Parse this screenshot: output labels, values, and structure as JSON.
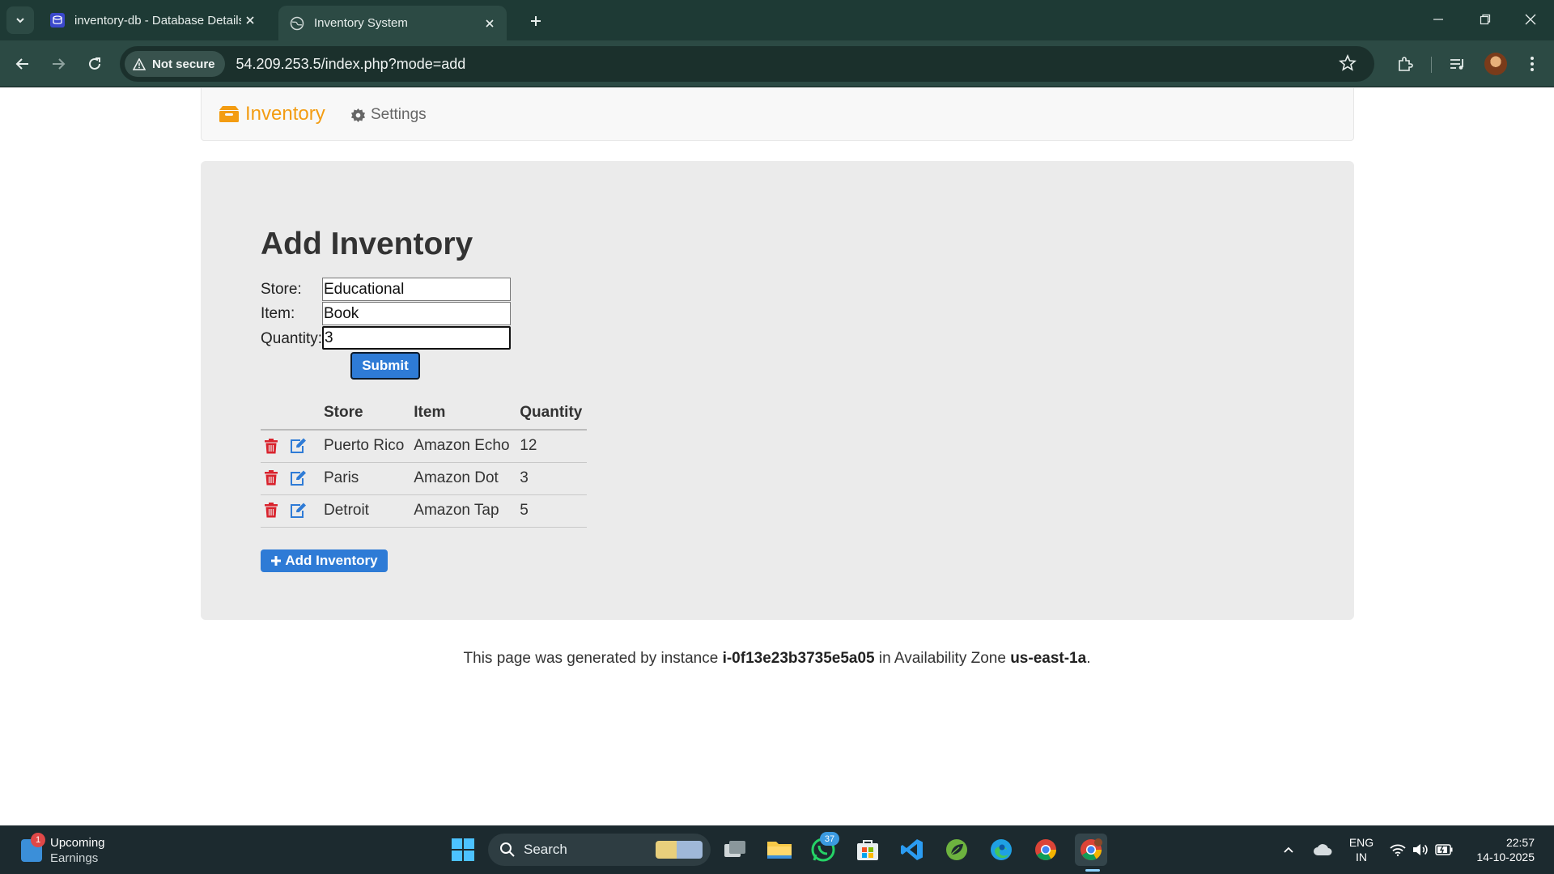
{
  "browser": {
    "tabs": [
      {
        "title": "inventory-db - Database Details",
        "active": false,
        "icon": "rds-database-icon"
      },
      {
        "title": "Inventory System",
        "active": true,
        "icon": "globe-icon"
      }
    ],
    "security_label": "Not secure",
    "url": "54.209.253.5/index.php?mode=add"
  },
  "nav": {
    "brand": "Inventory",
    "settings": "Settings",
    "brand_color": "#f39c12"
  },
  "form": {
    "title": "Add Inventory",
    "store_label": "Store:",
    "store_value": "Educational",
    "item_label": "Item:",
    "item_value": "Book",
    "quantity_label": "Quantity:",
    "quantity_value": "3",
    "submit_label": "Submit"
  },
  "table": {
    "headers": {
      "store": "Store",
      "item": "Item",
      "quantity": "Quantity"
    },
    "rows": [
      {
        "store": "Puerto Rico",
        "item": "Amazon Echo",
        "quantity": "12"
      },
      {
        "store": "Paris",
        "item": "Amazon Dot",
        "quantity": "3"
      },
      {
        "store": "Detroit",
        "item": "Amazon Tap",
        "quantity": "5"
      }
    ],
    "delete_icon_color": "#d9232d",
    "edit_icon_color": "#2e7bd6"
  },
  "add_button_label": "Add Inventory",
  "footer": {
    "prefix": "This page was generated by instance",
    "instance_id": "i-0f13e23b3735e5a05",
    "middle": "in Availability Zone",
    "zone": "us-east-1a",
    "suffix": "."
  },
  "taskbar": {
    "widget_title": "Upcoming",
    "widget_subtitle": "Earnings",
    "widget_badge": "1",
    "search_placeholder": "Search",
    "whatsapp_badge": "37",
    "lang_line1": "ENG",
    "lang_line2": "IN",
    "time": "22:57",
    "date": "14-10-2025"
  }
}
